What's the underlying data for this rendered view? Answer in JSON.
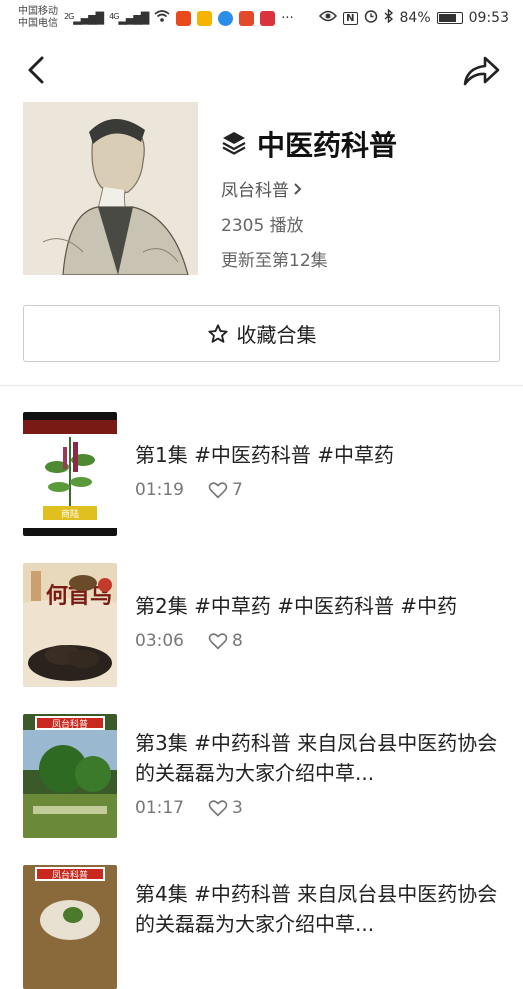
{
  "status_bar": {
    "carrier1": "中国移动",
    "carrier2": "中国电信",
    "net1": "2G",
    "net2": "4G",
    "more": "···",
    "battery": "84%",
    "battery_level": 0.84,
    "time": "09:53"
  },
  "collection": {
    "title": "中医药科普",
    "author": "凤台科普",
    "plays": "2305 播放",
    "update": "更新至第12集"
  },
  "favorite_button": {
    "label": "收藏合集"
  },
  "episodes": [
    {
      "title": "第1集   #中医药科普 #中草药",
      "duration": "01:19",
      "likes": "7",
      "thumb_text": "商陆"
    },
    {
      "title": "第2集   #中草药 #中医药科普 #中药",
      "duration": "03:06",
      "likes": "8",
      "thumb_text": "何首乌"
    },
    {
      "title": "第3集   #中药科普 来自凤台县中医药协会的关磊磊为大家介绍中草...",
      "duration": "01:17",
      "likes": "3",
      "thumb_text": "凤台科普"
    },
    {
      "title": "第4集   #中药科普 来自凤台县中医药协会的关磊磊为大家介绍中草...",
      "duration": "",
      "likes": "",
      "thumb_text": "凤台科普"
    }
  ],
  "colors": {
    "accent": "#222222",
    "muted": "#777777",
    "border": "#cccccc"
  }
}
